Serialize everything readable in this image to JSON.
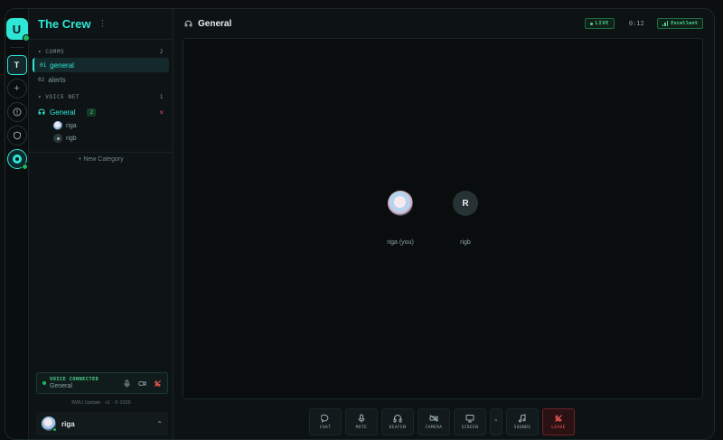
{
  "server": {
    "name": "The Crew",
    "logo_letter": "U",
    "rail": [
      {
        "label": "T",
        "icon": "server-initial"
      },
      {
        "label": "+",
        "icon": "plus-icon"
      },
      {
        "label": "",
        "icon": "compass-icon"
      },
      {
        "label": "",
        "icon": "shield-icon"
      }
    ]
  },
  "sidebar": {
    "categories": [
      {
        "name": "COMMS",
        "count": "2"
      },
      {
        "name": "VOICE NET",
        "count": "1"
      }
    ],
    "text_channels": [
      {
        "prefix": "01",
        "name": "general",
        "active": true
      },
      {
        "prefix": "02",
        "name": "alerts",
        "active": false
      }
    ],
    "voice_channel": {
      "name": "General",
      "count": "2",
      "close": "×"
    },
    "members": [
      {
        "name": "riga",
        "avatar": "image"
      },
      {
        "name": "rigb",
        "avatar": "default"
      }
    ],
    "new_category": "+ New Category",
    "voice_status": {
      "status": "VOICE CONNECTED",
      "channel": "General"
    },
    "footer": "BWU Update · v1 · © 2026",
    "user": {
      "name": "riga"
    }
  },
  "main": {
    "title": "General",
    "live_label": "LIVE",
    "timer": "0:12",
    "quality": "Excellent",
    "participants": [
      {
        "name": "riga (you)",
        "initial": "",
        "avatar": "image"
      },
      {
        "name": "rigb",
        "initial": "R",
        "avatar": "letter"
      }
    ],
    "controls": [
      {
        "label": "CHAT",
        "icon": "chat-icon"
      },
      {
        "label": "MUTE",
        "icon": "mic-icon"
      },
      {
        "label": "DEAFEN",
        "icon": "headphones-icon"
      },
      {
        "label": "CAMERA",
        "icon": "camera-off-icon"
      },
      {
        "label": "SCREEN",
        "icon": "screen-icon"
      },
      {
        "label": "",
        "icon": "chevron-up-icon"
      },
      {
        "label": "SOUNDS",
        "icon": "music-icon"
      },
      {
        "label": "LEAVE",
        "icon": "phone-off-icon"
      }
    ]
  },
  "colors": {
    "accent": "#2ee6d6",
    "online": "#1fb95f",
    "danger": "#ff5b5b",
    "bg": "#0b0f10"
  }
}
